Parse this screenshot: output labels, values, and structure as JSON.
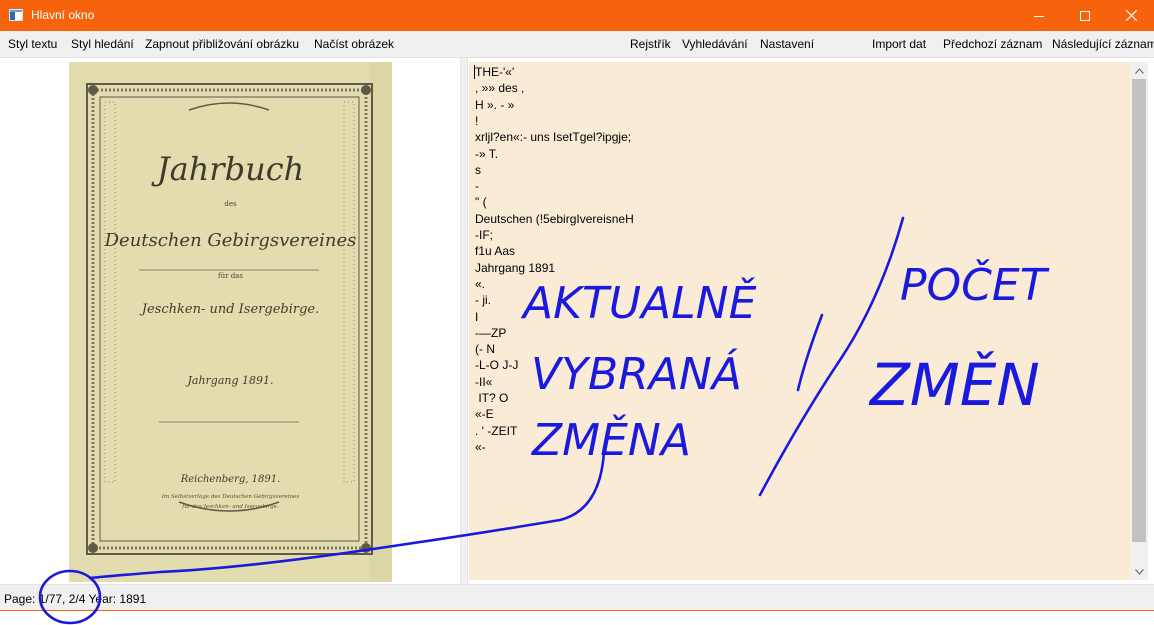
{
  "window": {
    "title": "Hlavní okno",
    "accent_color": "#f7630c",
    "controls": [
      "minimize-icon",
      "maximize-icon",
      "close-icon"
    ]
  },
  "menu": {
    "left": [
      "Styl textu",
      "Styl hledání",
      "Zapnout přibližování obrázku",
      "Načíst obrázek"
    ],
    "middle": [
      "Rejstřík",
      "Vyhledávání",
      "Nastavení"
    ],
    "right": [
      "Import dat",
      "Předchozí záznam",
      "Následující záznam"
    ]
  },
  "book_cover": {
    "title_line1": "Jahrbuch",
    "title_line2": "des",
    "title_line3": "Deutschen Gebirgsvereines",
    "title_line4": "für das",
    "title_line5": "Jeschken- und Isergebirge.",
    "year_line": "Jahrgang 1891.",
    "city_line": "Reichenberg, 1891.",
    "footer_line1": "Im Selbstverlage des Deutschen Gebirgsvereines",
    "footer_line2": "für das Jeschken- und Isergebirge.",
    "paper_color": "#e2dcae"
  },
  "ocr_text": {
    "background_color": "#faebd7",
    "lines": [
      "THE-'«'",
      ", »» des ,",
      "H ». - »",
      "!",
      "xrljl?en«:- uns IsetTgel?ipgje;",
      "-» T.",
      "s",
      "-",
      "\" (",
      "Deutschen (!5ebirgIvereisneH",
      "-IF;",
      "f1u Aas",
      "Jahrgang 1891",
      "«.",
      "- ji.",
      "I",
      "-—ZP",
      "(- N",
      "-L-O J-J",
      "-II«",
      " IT? O",
      "«-E",
      ". ' -ZEIT",
      "«-"
    ]
  },
  "status": {
    "text": "Page: 1/77, 2/4  Year: 1891"
  },
  "annotation": {
    "color": "#1a1adf",
    "line1": "AKTUALNĚ",
    "line2": "VYBRANÁ",
    "line3": "ZMĚNA",
    "line4": "POČET",
    "line5": "ZMĚN"
  }
}
